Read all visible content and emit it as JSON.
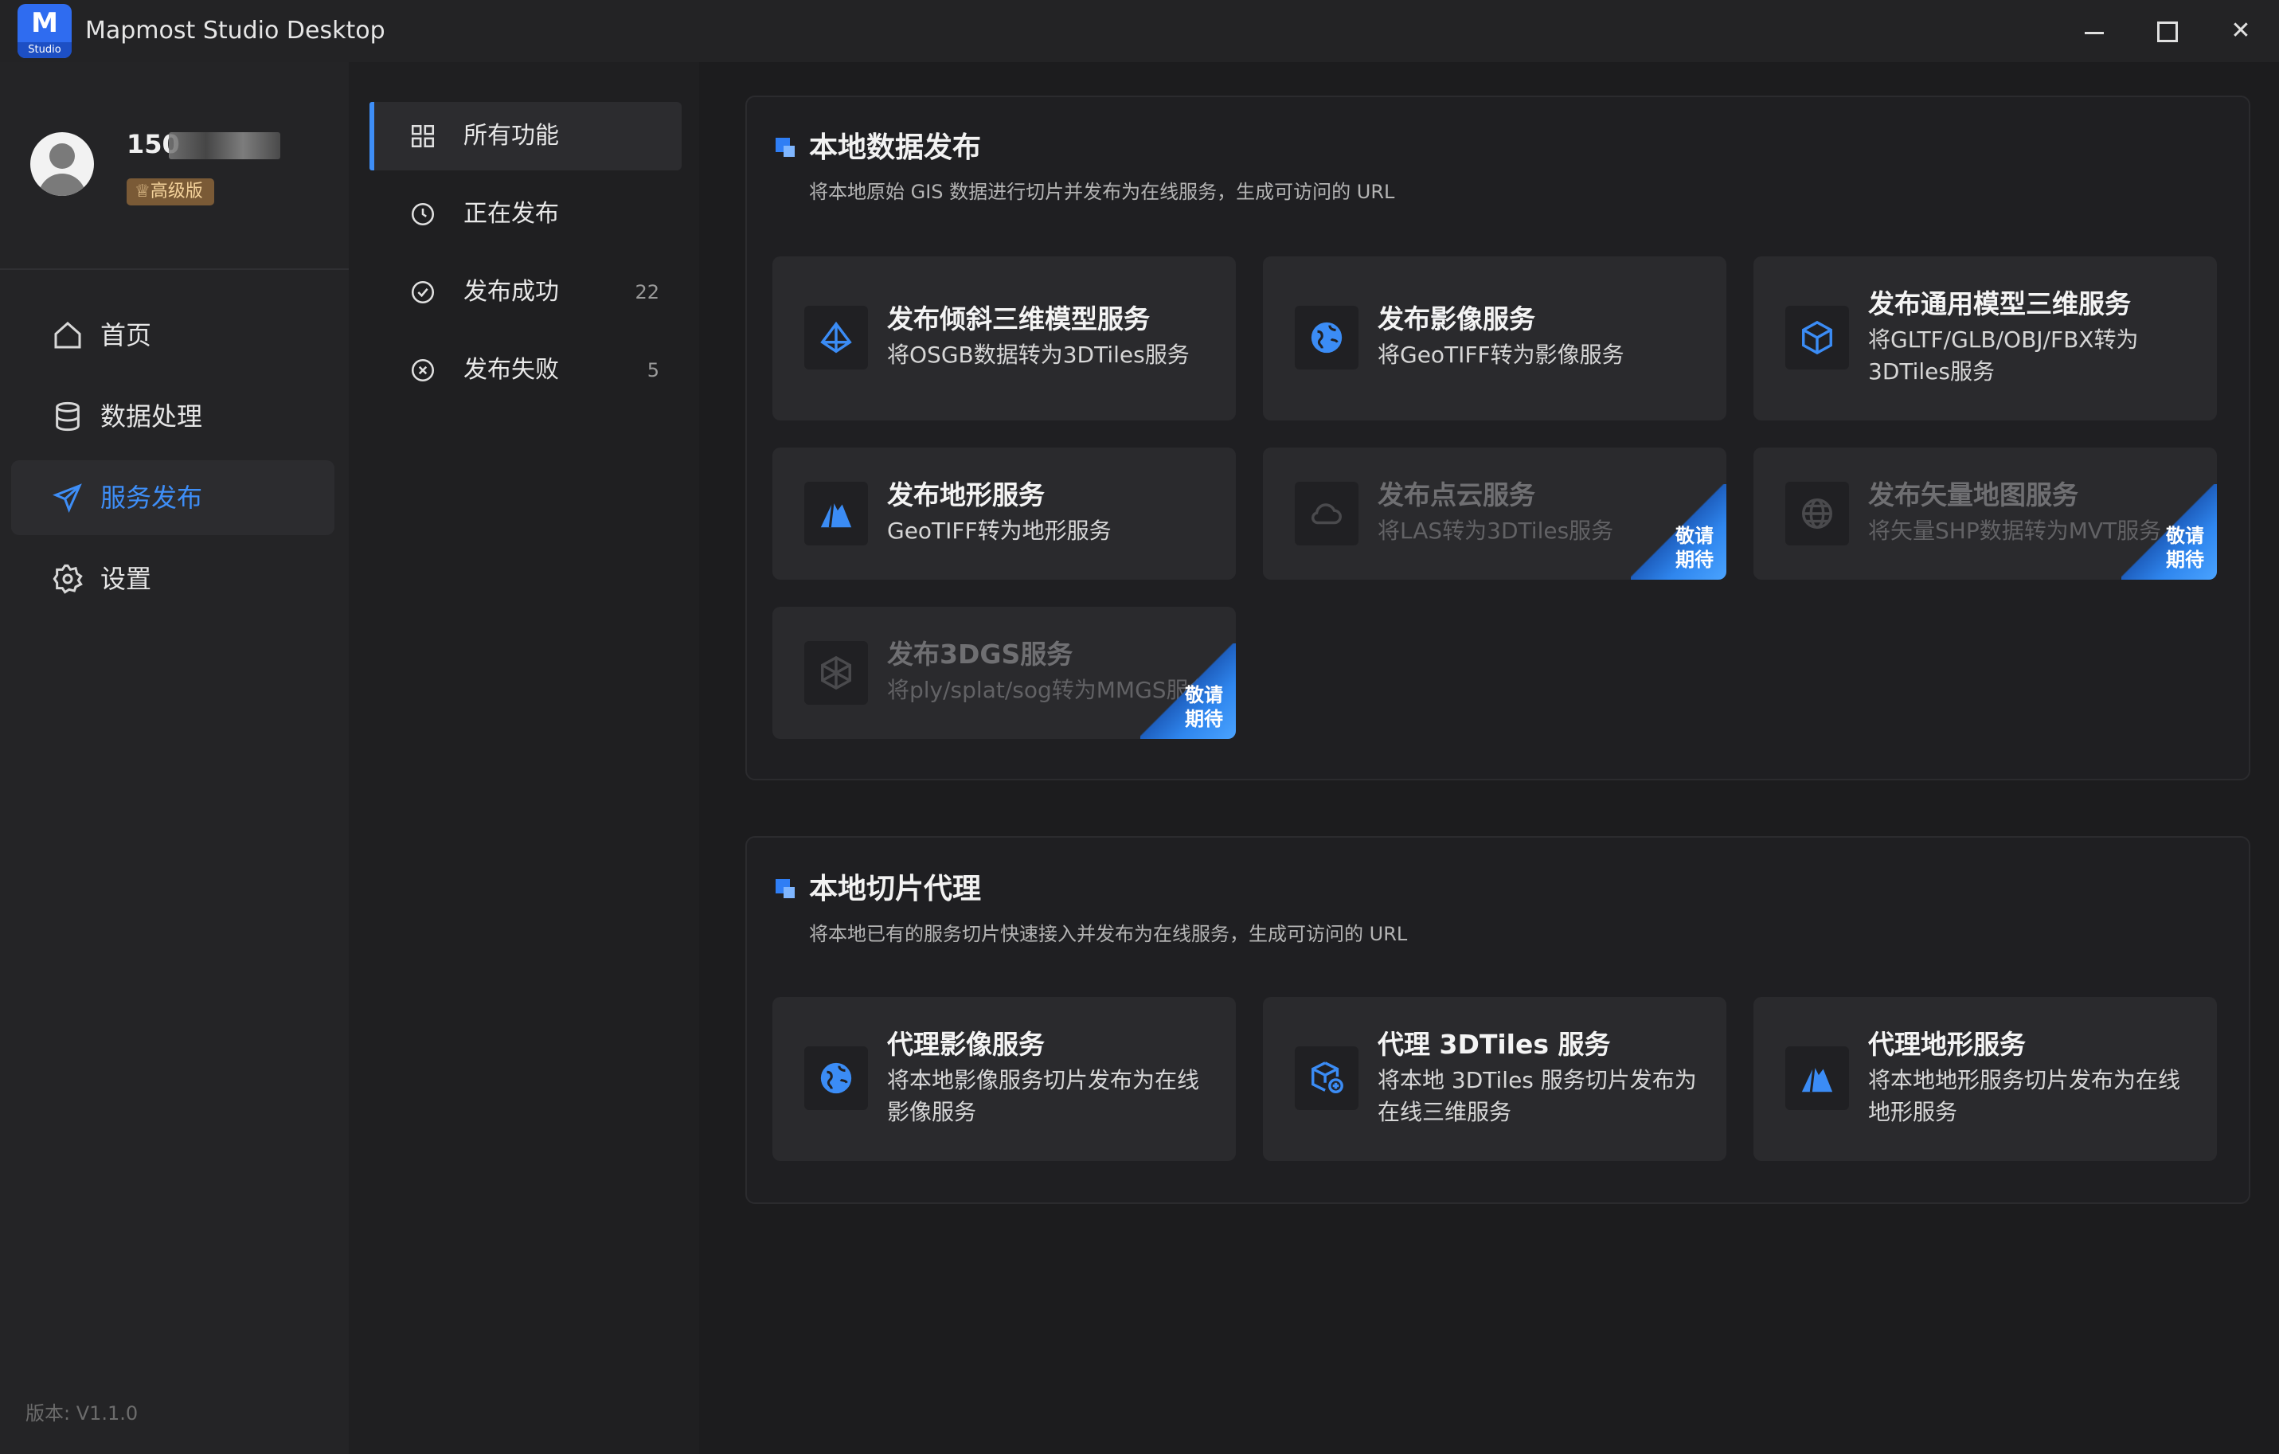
{
  "window": {
    "app_logo_text": "M",
    "app_logo_tag": "Studio",
    "title": "Mapmost Studio Desktop",
    "minimize_icon": "minimize-icon",
    "maximize_icon": "maximize-icon",
    "close_label": "✕"
  },
  "user": {
    "phone_visible": "150",
    "tier": "高级版",
    "tier_icon": "crown-icon"
  },
  "nav": {
    "items": [
      {
        "label": "首页",
        "icon": "home-icon"
      },
      {
        "label": "数据处理",
        "icon": "database-icon"
      },
      {
        "label": "服务发布",
        "icon": "send-icon"
      },
      {
        "label": "设置",
        "icon": "gear-icon"
      }
    ],
    "active_index": 2,
    "version": "版本: V1.1.0"
  },
  "subnav": {
    "items": [
      {
        "label": "所有功能",
        "icon": "grid-icon",
        "count": ""
      },
      {
        "label": "正在发布",
        "icon": "clock-icon",
        "count": ""
      },
      {
        "label": "发布成功",
        "icon": "check-circle-icon",
        "count": "22"
      },
      {
        "label": "发布失败",
        "icon": "x-circle-icon",
        "count": "5"
      }
    ],
    "active_index": 0
  },
  "sections": {
    "local_publish": {
      "title": "本地数据发布",
      "desc": "将本地原始 GIS 数据进行切片并发布为在线服务，生成可访问的 URL",
      "cards": [
        {
          "title": "发布倾斜三维模型服务",
          "desc": "将OSGB数据转为3DTiles服务",
          "icon": "pyramid-icon",
          "disabled": false
        },
        {
          "title": "发布影像服务",
          "desc": "将GeoTIFF转为影像服务",
          "icon": "globe-icon",
          "disabled": false
        },
        {
          "title": "发布通用模型三维服务",
          "desc": "将GLTF/GLB/OBJ/FBX转为3DTiles服务",
          "icon": "cube-icon",
          "disabled": false
        },
        {
          "title": "发布地形服务",
          "desc": "GeoTIFF转为地形服务",
          "icon": "mountain-icon",
          "disabled": false
        },
        {
          "title": "发布点云服务",
          "desc": "将LAS转为3DTiles服务",
          "icon": "cloud-icon",
          "disabled": true
        },
        {
          "title": "发布矢量地图服务",
          "desc": "将矢量SHP数据转为MVT服务",
          "icon": "globe-grid-icon",
          "disabled": true
        },
        {
          "title": "发布3DGS服务",
          "desc": "将ply/splat/sog转为MMGS服务",
          "icon": "gaussian-icon",
          "disabled": true
        }
      ],
      "coming_soon": "敬请期待"
    },
    "tile_proxy": {
      "title": "本地切片代理",
      "desc": "将本地已有的服务切片快速接入并发布为在线服务，生成可访问的 URL",
      "cards": [
        {
          "title": "代理影像服务",
          "desc": "将本地影像服务切片发布为在线影像服务",
          "icon": "globe-icon"
        },
        {
          "title": "代理 3DTiles 服务",
          "desc": "将本地 3DTiles 服务切片发布为在线三维服务",
          "icon": "cube-sync-icon"
        },
        {
          "title": "代理地形服务",
          "desc": "将本地地形服务切片发布为在线地形服务",
          "icon": "mountain-icon"
        }
      ]
    }
  },
  "colors": {
    "accent": "#3e8ef7",
    "background": "#1c1c1e",
    "card": "#2a2a2d",
    "vip_badge": "#7a5a36"
  }
}
